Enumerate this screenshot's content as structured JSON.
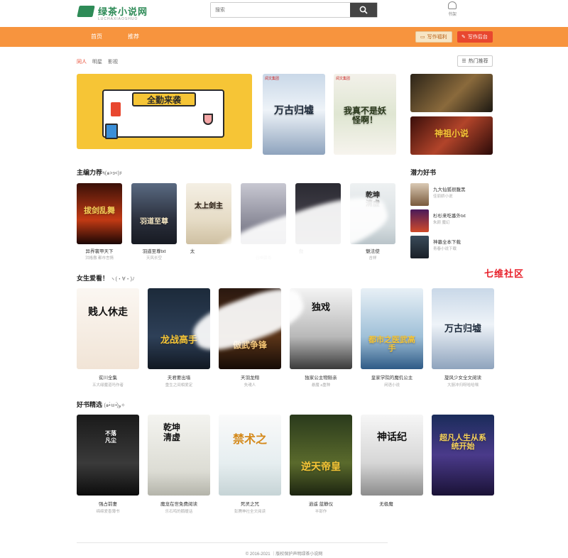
{
  "header": {
    "logo_text": "绿茶小说网",
    "logo_sub": "LUCHAXIAOSHUO",
    "search_placeholder": "搜索",
    "bookshelf_label": "书架"
  },
  "nav": {
    "items": [
      "首页",
      "推荐"
    ],
    "write_welfare": "写作福利",
    "write_backend": "写作后台"
  },
  "categories": [
    "同人",
    "明星",
    "影视"
  ],
  "hot_button": "热门推荐",
  "banner": {
    "text": "全勤来袭"
  },
  "top_covers": [
    {
      "cover_text": "万古归墟",
      "tag": "阅文集团"
    },
    {
      "cover_text": "我真不是妖怪啊！",
      "tag": "阅文集团"
    },
    {
      "cover_text": "",
      "tag": ""
    },
    {
      "cover_text": "神祖小说",
      "tag": ""
    }
  ],
  "editor_section": {
    "title": "主编力荐",
    "kaomoji": "٩(๑>з<)۶",
    "books": [
      {
        "name": "异界寰甲天下",
        "author": "洪格傲 都市言情",
        "cover": "拔剑乱舞"
      },
      {
        "name": "羽道至尊txt",
        "author": "天风长空",
        "cover": "羽道至尊"
      },
      {
        "name": "太",
        "author": "",
        "cover": "太上剑主"
      },
      {
        "name": "",
        "author": "召唤骤雨",
        "cover": ""
      },
      {
        "name": "傲",
        "author": "",
        "cover": ""
      },
      {
        "name": "魅法使",
        "author": "吉祥",
        "cover": "乾坤清虚"
      }
    ]
  },
  "potential_section": {
    "title": "潜力好书",
    "books": [
      {
        "name": "九大仙狐很腹黑",
        "author": "佳丽娇小说"
      },
      {
        "name": "杉杉来吃番外txt",
        "author": "朱颜 魔幻"
      },
      {
        "name": "神墓全本下载",
        "author": "青春小说下载"
      }
    ]
  },
  "girls_section": {
    "title": "女生爱看！",
    "kaomoji": "ヽ(・∀・)ﾉ",
    "books": [
      {
        "name": "贫川全集",
        "author": "五大绿魔道吗作者",
        "cover": "贱人休走"
      },
      {
        "name": "夫君要出墙",
        "author": "重生之间相爱定",
        "cover": "龙战高手"
      },
      {
        "name": "天羽龙翔",
        "author": "失魂人",
        "cover": "傲武争锋"
      },
      {
        "name": "独家公主物陨亲",
        "author": "悬魔 a重种",
        "cover": "独戏"
      },
      {
        "name": "皇家学院的魔仉公主",
        "author": "闲语小说",
        "cover": "都市之医武高手"
      },
      {
        "name": "旋风少女全文阅读",
        "author": "大厨冲归呀哈哈嘿",
        "cover": "万古归墟"
      }
    ]
  },
  "picks_section": {
    "title": "好书精选",
    "kaomoji": "(๑•̀ㅂ•́)و✧",
    "books": [
      {
        "name": "强占前妻",
        "author": "绵绵爱香薄书",
        "cover": "不落凡尘"
      },
      {
        "name": "魔龙在世免费阅读",
        "author": "乐石鸣的鹅暖话",
        "cover": "乾坤清虚"
      },
      {
        "name": "死灵之咒",
        "author": "彭腾神社全文阅读",
        "cover": "禁术之"
      },
      {
        "name": "逍遥 蓝静仪",
        "author": "半部作",
        "cover": "逆天帝皇"
      },
      {
        "name": "无极魔",
        "author": "",
        "cover": "神话纪"
      },
      {
        "name": "",
        "author": "",
        "cover": "超凡人生从系统开始"
      }
    ]
  },
  "watermark": "七维社区",
  "footer": "© 2016-2021 ｜版权保护声明绿茶小说网",
  "colors": {
    "nav": "#f7943e",
    "accent": "#e8472f",
    "brand": "#2e8b57"
  }
}
